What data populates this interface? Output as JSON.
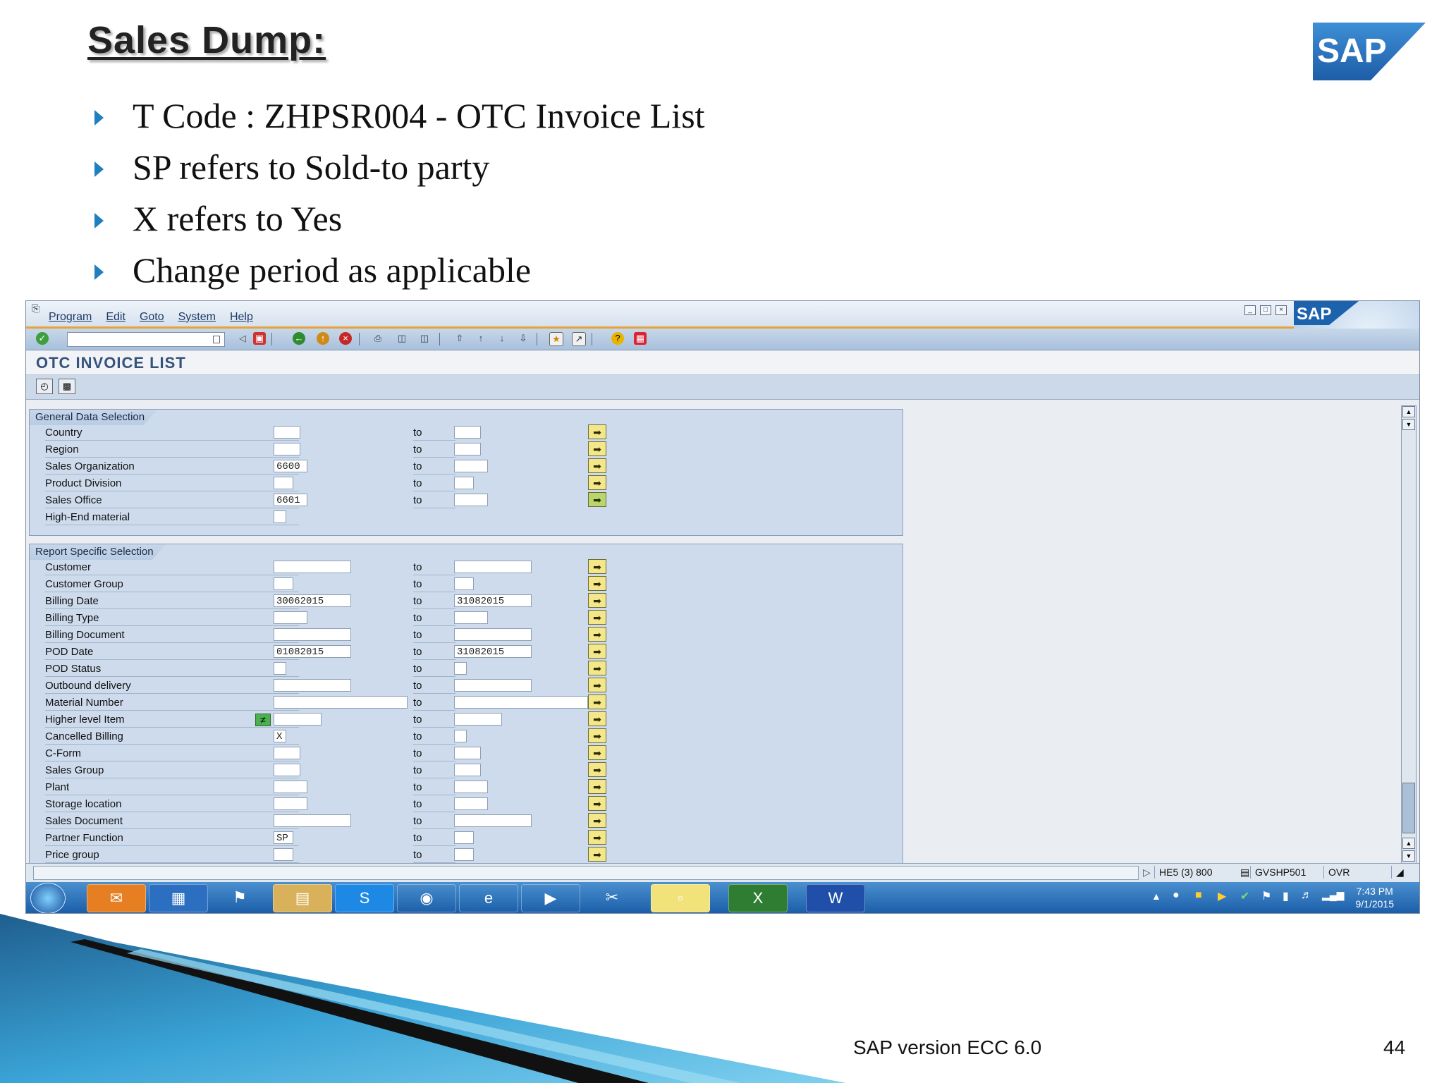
{
  "slide": {
    "title": "Sales Dump:",
    "bullets": [
      "T Code : ZHPSR004 - OTC Invoice List",
      "SP refers to Sold-to party",
      "X refers to Yes",
      "Change period as applicable"
    ],
    "logo_text": "SAP",
    "footer": "SAP version ECC 6.0",
    "page_number": "44"
  },
  "sap": {
    "menu": [
      "Program",
      "Edit",
      "Goto",
      "System",
      "Help"
    ],
    "logo_text": "SAP",
    "screen_title": "OTC INVOICE LIST",
    "general_section": {
      "title": "General Data Selection",
      "to_label": "to",
      "rows": [
        {
          "label": "Country",
          "from": "",
          "to": ""
        },
        {
          "label": "Region",
          "from": "",
          "to": ""
        },
        {
          "label": "Sales Organization",
          "from": "6600",
          "to": ""
        },
        {
          "label": "Product Division",
          "from": "",
          "to": ""
        },
        {
          "label": "Sales Office",
          "from": "6601",
          "to": ""
        },
        {
          "label": "High-End material",
          "from": ""
        }
      ]
    },
    "report_section": {
      "title": "Report Specific Selection",
      "to_label": "to",
      "rows": [
        {
          "label": "Customer",
          "from": "",
          "to": ""
        },
        {
          "label": "Customer Group",
          "from": "",
          "to": ""
        },
        {
          "label": "Billing Date",
          "from": "30062015",
          "to": "31082015"
        },
        {
          "label": "Billing Type",
          "from": "",
          "to": ""
        },
        {
          "label": "Billing Document",
          "from": "",
          "to": ""
        },
        {
          "label": "POD Date",
          "from": "01082015",
          "to": "31082015"
        },
        {
          "label": "POD Status",
          "from": "",
          "to": ""
        },
        {
          "label": "Outbound delivery",
          "from": "",
          "to": ""
        },
        {
          "label": "Material Number",
          "from": "",
          "to": ""
        },
        {
          "label": "Higher level Item",
          "from": "",
          "to": ""
        },
        {
          "label": "Cancelled Billing",
          "from": "X",
          "to": ""
        },
        {
          "label": "C-Form",
          "from": "",
          "to": ""
        },
        {
          "label": "Sales Group",
          "from": "",
          "to": ""
        },
        {
          "label": "Plant",
          "from": "",
          "to": ""
        },
        {
          "label": "Storage location",
          "from": "",
          "to": ""
        },
        {
          "label": "Sales Document",
          "from": "",
          "to": ""
        },
        {
          "label": "Partner Function",
          "from": "SP",
          "to": ""
        },
        {
          "label": "Price group",
          "from": "",
          "to": ""
        }
      ]
    },
    "status": {
      "system": "HE5 (3) 800",
      "server": "GVSHP501",
      "mode": "OVR"
    },
    "taskbar": {
      "time": "7:43 PM",
      "date": "9/1/2015"
    }
  }
}
